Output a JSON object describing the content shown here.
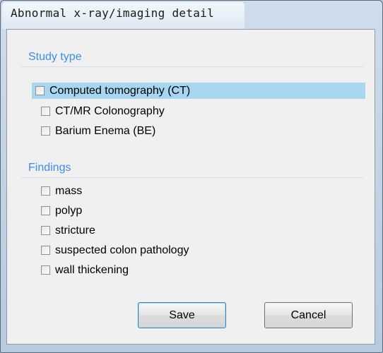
{
  "window": {
    "title": "Abnormal x-ray/imaging detail"
  },
  "study_type": {
    "heading": "Study type",
    "items": [
      {
        "label": "Computed tomography (CT)",
        "checked": false,
        "selected": true
      },
      {
        "label": "CT/MR Colonography",
        "checked": false,
        "selected": false
      },
      {
        "label": "Barium Enema (BE)",
        "checked": false,
        "selected": false
      }
    ]
  },
  "findings": {
    "heading": "Findings",
    "items": [
      {
        "label": "mass",
        "checked": false
      },
      {
        "label": "polyp",
        "checked": false
      },
      {
        "label": "stricture",
        "checked": false
      },
      {
        "label": "suspected colon pathology",
        "checked": false
      },
      {
        "label": "wall thickening",
        "checked": false
      }
    ]
  },
  "buttons": {
    "save_label": "Save",
    "cancel_label": "Cancel"
  },
  "colors": {
    "heading": "#3a8ee8",
    "selection": "#a6d6f0"
  }
}
